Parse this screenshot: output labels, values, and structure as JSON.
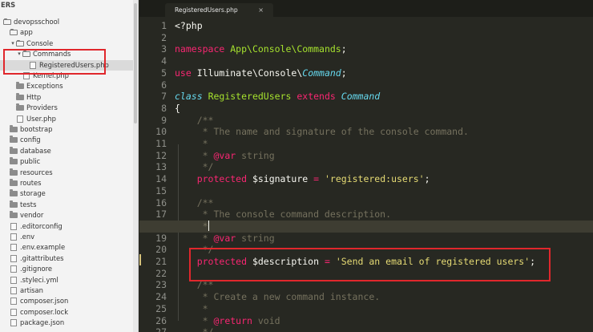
{
  "sidebar": {
    "header": "ERS",
    "rows": [
      {
        "label": "devopsschool",
        "kind": "folder",
        "depth": 0,
        "open": true
      },
      {
        "label": "app",
        "kind": "folder",
        "depth": 1,
        "open": true
      },
      {
        "label": "Console",
        "kind": "folder",
        "depth": 2,
        "open": true
      },
      {
        "label": "Commands",
        "kind": "folder",
        "depth": 3,
        "open": true
      },
      {
        "label": "RegisteredUsers.php",
        "kind": "file",
        "depth": 4,
        "selected": true
      },
      {
        "label": "Kernel.php",
        "kind": "file",
        "depth": 3
      },
      {
        "label": "Exceptions",
        "kind": "folder",
        "depth": 2
      },
      {
        "label": "Http",
        "kind": "folder",
        "depth": 2
      },
      {
        "label": "Providers",
        "kind": "folder",
        "depth": 2
      },
      {
        "label": "User.php",
        "kind": "file",
        "depth": 2
      },
      {
        "label": "bootstrap",
        "kind": "folder",
        "depth": 1
      },
      {
        "label": "config",
        "kind": "folder",
        "depth": 1
      },
      {
        "label": "database",
        "kind": "folder",
        "depth": 1
      },
      {
        "label": "public",
        "kind": "folder",
        "depth": 1
      },
      {
        "label": "resources",
        "kind": "folder",
        "depth": 1
      },
      {
        "label": "routes",
        "kind": "folder",
        "depth": 1
      },
      {
        "label": "storage",
        "kind": "folder",
        "depth": 1
      },
      {
        "label": "tests",
        "kind": "folder",
        "depth": 1
      },
      {
        "label": "vendor",
        "kind": "folder",
        "depth": 1
      },
      {
        "label": ".editorconfig",
        "kind": "file",
        "depth": 1
      },
      {
        "label": ".env",
        "kind": "file",
        "depth": 1
      },
      {
        "label": ".env.example",
        "kind": "file",
        "depth": 1
      },
      {
        "label": ".gitattributes",
        "kind": "file",
        "depth": 1
      },
      {
        "label": ".gitignore",
        "kind": "file",
        "depth": 1
      },
      {
        "label": ".styleci.yml",
        "kind": "file",
        "depth": 1
      },
      {
        "label": "artisan",
        "kind": "file",
        "depth": 1
      },
      {
        "label": "composer.json",
        "kind": "file",
        "depth": 1
      },
      {
        "label": "composer.lock",
        "kind": "file",
        "depth": 1
      },
      {
        "label": "package.json",
        "kind": "file",
        "depth": 1
      }
    ]
  },
  "tab": {
    "title": "RegisteredUsers.php",
    "close": "×"
  },
  "editor": {
    "current_line": 18,
    "lines": [
      {
        "n": "1",
        "tokens": [
          [
            "pl",
            "<?php"
          ]
        ]
      },
      {
        "n": "2",
        "tokens": []
      },
      {
        "n": "3",
        "tokens": [
          [
            "kw",
            "namespace"
          ],
          [
            "pl",
            " "
          ],
          [
            "cl",
            "App\\Console\\Commands"
          ],
          [
            "pl",
            ";"
          ]
        ]
      },
      {
        "n": "4",
        "tokens": []
      },
      {
        "n": "5",
        "tokens": [
          [
            "kw",
            "use"
          ],
          [
            "pl",
            " Illuminate\\Console\\"
          ],
          [
            "st",
            "Command"
          ],
          [
            "pl",
            ";"
          ]
        ]
      },
      {
        "n": "6",
        "tokens": []
      },
      {
        "n": "7",
        "tokens": [
          [
            "st",
            "class"
          ],
          [
            "pl",
            " "
          ],
          [
            "cl",
            "RegisteredUsers"
          ],
          [
            "pl",
            " "
          ],
          [
            "kw",
            "extends"
          ],
          [
            "pl",
            " "
          ],
          [
            "st",
            "Command"
          ]
        ]
      },
      {
        "n": "8",
        "tokens": [
          [
            "pl",
            "{"
          ]
        ]
      },
      {
        "n": "9",
        "tokens": [
          [
            "cm",
            "    /**"
          ]
        ]
      },
      {
        "n": "10",
        "tokens": [
          [
            "cm",
            "     * The name and signature of the console command."
          ]
        ]
      },
      {
        "n": "11",
        "tokens": [
          [
            "cm",
            "     *"
          ]
        ]
      },
      {
        "n": "12",
        "tokens": [
          [
            "cm",
            "     * "
          ],
          [
            "tag",
            "@var"
          ],
          [
            "cm",
            " string"
          ]
        ]
      },
      {
        "n": "13",
        "tokens": [
          [
            "cm",
            "     */"
          ]
        ]
      },
      {
        "n": "14",
        "tokens": [
          [
            "pl",
            "    "
          ],
          [
            "kw",
            "protected"
          ],
          [
            "pl",
            " $signature "
          ],
          [
            "kw",
            "="
          ],
          [
            "pl",
            " "
          ],
          [
            "str",
            "'registered:users'"
          ],
          [
            "pl",
            ";"
          ]
        ]
      },
      {
        "n": "15",
        "tokens": []
      },
      {
        "n": "16",
        "tokens": [
          [
            "cm",
            "    /**"
          ]
        ]
      },
      {
        "n": "17",
        "tokens": [
          [
            "cm",
            "     * The console command description."
          ]
        ]
      },
      {
        "n": "18",
        "tokens": [
          [
            "cm",
            "     *"
          ]
        ]
      },
      {
        "n": "19",
        "tokens": [
          [
            "cm",
            "     * "
          ],
          [
            "tag",
            "@var"
          ],
          [
            "cm",
            " string"
          ]
        ]
      },
      {
        "n": "20",
        "tokens": [
          [
            "cm",
            "     */"
          ]
        ]
      },
      {
        "n": "21",
        "tokens": [
          [
            "pl",
            "    "
          ],
          [
            "kw",
            "protected"
          ],
          [
            "pl",
            " $description "
          ],
          [
            "kw",
            "="
          ],
          [
            "pl",
            " "
          ],
          [
            "str",
            "'Send an email of registered users'"
          ],
          [
            "pl",
            ";"
          ]
        ]
      },
      {
        "n": "22",
        "tokens": []
      },
      {
        "n": "23",
        "tokens": [
          [
            "cm",
            "    /**"
          ]
        ]
      },
      {
        "n": "24",
        "tokens": [
          [
            "cm",
            "     * Create a new command instance."
          ]
        ]
      },
      {
        "n": "25",
        "tokens": [
          [
            "cm",
            "     *"
          ]
        ]
      },
      {
        "n": "26",
        "tokens": [
          [
            "cm",
            "     * "
          ],
          [
            "tag",
            "@return"
          ],
          [
            "cm",
            " void"
          ]
        ]
      },
      {
        "n": "27",
        "tokens": [
          [
            "cm",
            "     */"
          ]
        ]
      }
    ]
  }
}
